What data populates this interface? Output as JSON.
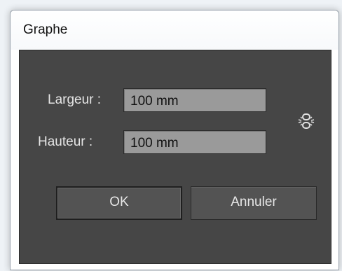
{
  "dialog": {
    "title": "Graphe",
    "width": {
      "label": "Largeur :",
      "value": "100 mm"
    },
    "height": {
      "label": "Hauteur :",
      "value": "100 mm"
    },
    "link_icon": "constrain-proportions-link-icon",
    "buttons": {
      "ok_label": "OK",
      "cancel_label": "Annuler"
    },
    "colors": {
      "panel_bg": "#464646",
      "input_bg": "#9a9a9a",
      "text": "#e6e6e6"
    }
  }
}
